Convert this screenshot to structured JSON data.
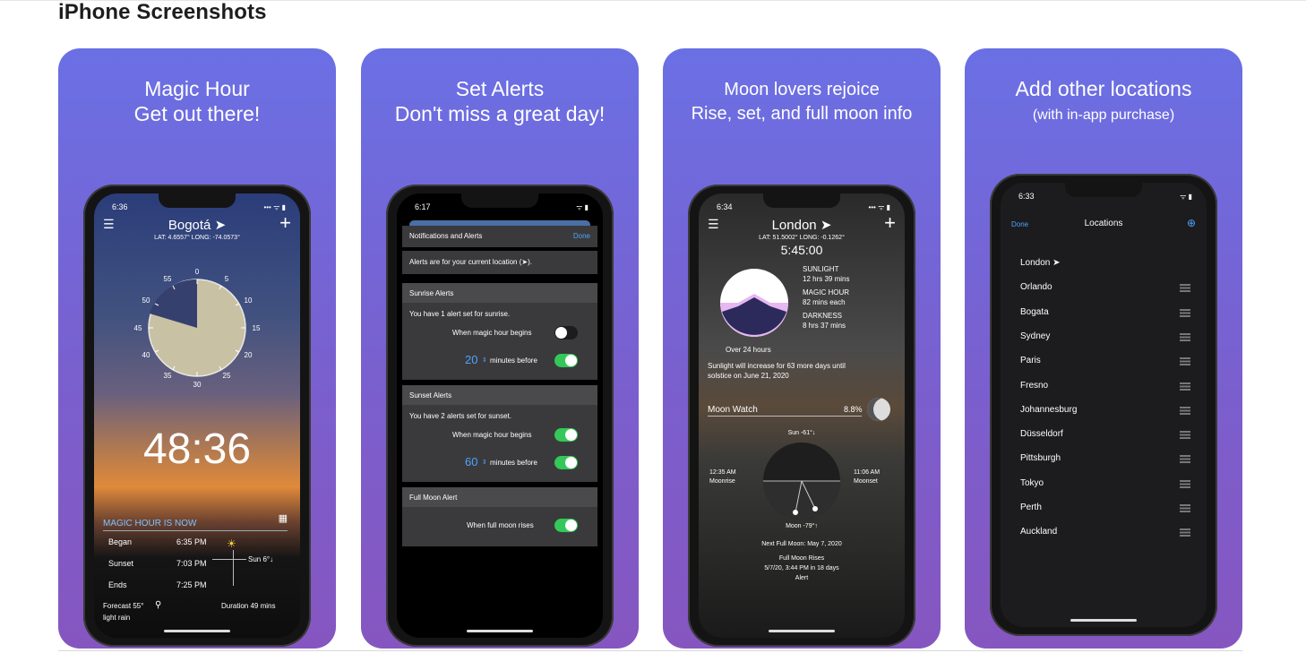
{
  "heading": "iPhone Screenshots",
  "cards": [
    {
      "caption_line1": "Magic Hour",
      "caption_line2": "Get out there!",
      "screen": {
        "time": "6:36",
        "city": "Bogotá ➤",
        "coords": "LAT: 4.6557°  LONG: -74.0573°",
        "dial_labels": [
          "0",
          "5",
          "10",
          "15",
          "20",
          "25",
          "30",
          "35",
          "40",
          "45",
          "50",
          "55"
        ],
        "countdown": "48:36",
        "status_label": "MAGIC HOUR IS NOW",
        "rows": [
          {
            "label": "Began",
            "value": "6:35 PM"
          },
          {
            "label": "Sunset",
            "value": "7:03 PM"
          },
          {
            "label": "Ends",
            "value": "7:25 PM"
          }
        ],
        "sun_label": "Sun 6°↓",
        "forecast_line1": "Forecast 55°",
        "forecast_line2": "light rain",
        "duration": "Duration 49 mins"
      }
    },
    {
      "caption_line1": "Set Alerts",
      "caption_line2": "Don't miss a great day!",
      "screen": {
        "time": "6:17",
        "title": "Notifications and Alerts",
        "done": "Done",
        "info": "Alerts are for your current location (➤).",
        "sunrise_header": "Sunrise Alerts",
        "sunrise_note": "You have 1 alert set for sunrise.",
        "sunrise_magic": "When magic hour begins",
        "sunrise_minutes": "20",
        "sunrise_minutes_label": "minutes before",
        "sunset_header": "Sunset Alerts",
        "sunset_note": "You have 2 alerts set for sunset.",
        "sunset_magic": "When magic hour begins",
        "sunset_minutes": "60",
        "sunset_minutes_label": "minutes before",
        "fullmoon_header": "Full Moon Alert",
        "fullmoon_label": "When full moon rises"
      }
    },
    {
      "caption_line1": "Moon lovers rejoice",
      "caption_line2": "Rise, set, and full moon info",
      "screen": {
        "time": "6:34",
        "city": "London ➤",
        "coords": "LAT: 51.5002°  LONG: -0.1262°",
        "clock": "5:45:00",
        "sunlight_label": "SUNLIGHT",
        "sunlight_value": "12 hrs 39 mins",
        "magic_label": "MAGIC HOUR",
        "magic_value": "82 mins each",
        "dark_label": "DARKNESS",
        "dark_value": "8 hrs 37 mins",
        "over24": "Over 24 hours",
        "sunlight_note1": "Sunlight will increase for 63 more days until",
        "sunlight_note2": "solstice on June 21, 2020",
        "moonwatch": "Moon Watch",
        "moon_pct": "8.8%",
        "sun_pos": "Sun -61°↓",
        "moonrise_time": "12:35 AM",
        "moonrise_label": "Moonrise",
        "moonset_time": "11:06 AM",
        "moonset_label": "Moonset",
        "moon_pos": "Moon -79°↑",
        "next_full": "Next Full Moon: May 7, 2020",
        "full_rises": "Full Moon Rises",
        "full_rises_when": "5/7/20, 3:44 PM in 18 days",
        "alert": "Alert"
      }
    },
    {
      "caption_line1": "Add other locations",
      "caption_line2": "(with in-app purchase)",
      "screen": {
        "time": "6:33",
        "done": "Done",
        "title": "Locations",
        "locations": [
          "London ➤",
          "Orlando",
          "Bogata",
          "Sydney",
          "Paris",
          "Fresno",
          "Johannesburg",
          "Düsseldorf",
          "Pittsburgh",
          "Tokyo",
          "Perth",
          "Auckland"
        ]
      }
    }
  ]
}
